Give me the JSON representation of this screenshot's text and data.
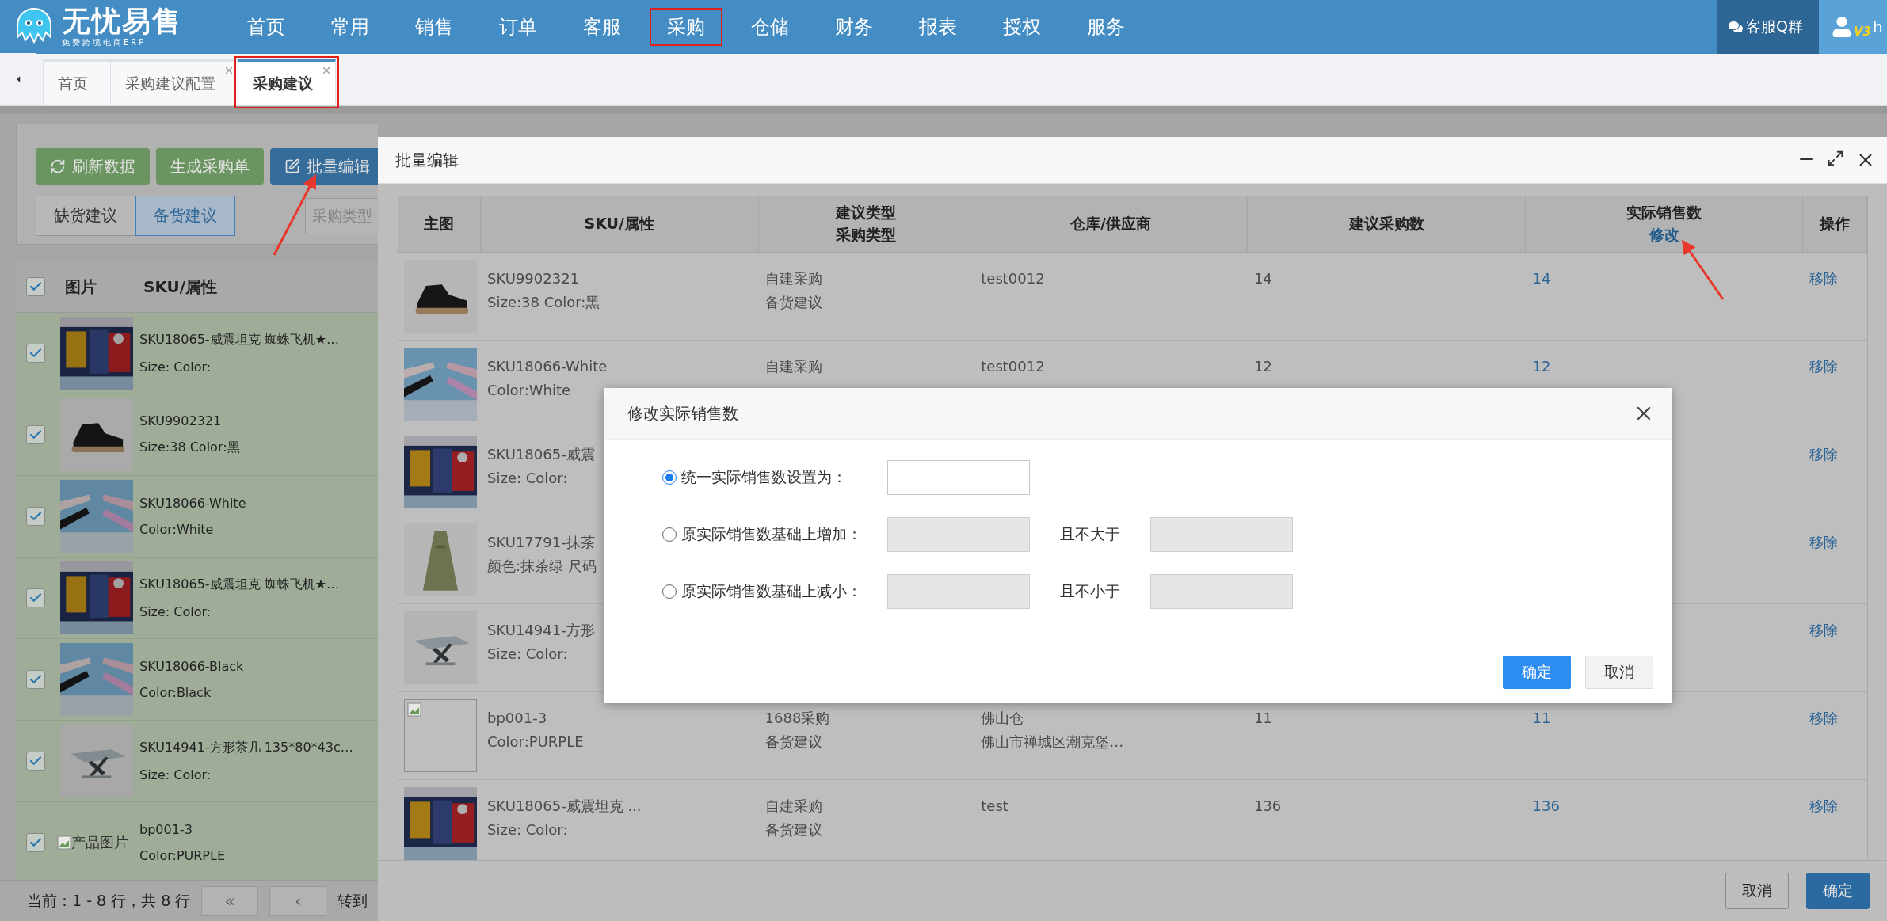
{
  "logo": {
    "title": "无忧易售",
    "subtitle": "免费跨境电商ERP"
  },
  "nav": [
    {
      "label": "首页",
      "highlighted": false
    },
    {
      "label": "常用",
      "highlighted": false
    },
    {
      "label": "销售",
      "highlighted": false
    },
    {
      "label": "订单",
      "highlighted": false
    },
    {
      "label": "客服",
      "highlighted": false
    },
    {
      "label": "采购",
      "highlighted": true
    },
    {
      "label": "仓储",
      "highlighted": false
    },
    {
      "label": "财务",
      "highlighted": false
    },
    {
      "label": "报表",
      "highlighted": false
    },
    {
      "label": "授权",
      "highlighted": false
    },
    {
      "label": "服务",
      "highlighted": false
    }
  ],
  "support_button": "客服Q群",
  "user": {
    "badge": "V3",
    "name": "h"
  },
  "tabs": [
    {
      "label": "首页",
      "selected": false,
      "closable": false,
      "highlighted": false
    },
    {
      "label": "采购建议配置",
      "selected": false,
      "closable": true,
      "highlighted": false
    },
    {
      "label": "采购建议",
      "selected": true,
      "closable": true,
      "highlighted": true
    }
  ],
  "toolbar": {
    "buttons": [
      {
        "label": "刷新数据",
        "kind": "refresh"
      },
      {
        "label": "生成采购单",
        "kind": "plain"
      },
      {
        "label": "批量编辑",
        "kind": "edit"
      }
    ],
    "segments": [
      {
        "label": "缺货建议",
        "selected": false
      },
      {
        "label": "备货建议",
        "selected": true
      }
    ],
    "type_select": {
      "placeholder": "采购类型"
    }
  },
  "list": {
    "all_checked": true,
    "columns": [
      "图片",
      "SKU/属性"
    ],
    "rows": [
      {
        "checked": true,
        "kind": "picture",
        "sku": "SKU18065-威震坦克 蜘蛛飞机★…",
        "attrs": "Size: Color:"
      },
      {
        "checked": true,
        "kind": "picture",
        "sku": "SKU9902321",
        "attrs": "Size:38 Color:黑"
      },
      {
        "checked": true,
        "kind": "picture",
        "sku": "SKU18066-White",
        "attrs": "Color:White"
      },
      {
        "checked": true,
        "kind": "picture",
        "sku": "SKU18065-威震坦克 蜘蛛飞机★…",
        "attrs": "Size: Color:"
      },
      {
        "checked": true,
        "kind": "picture",
        "sku": "SKU18066-Black",
        "attrs": "Color:Black"
      },
      {
        "checked": true,
        "kind": "picture",
        "sku": "SKU14941-方形茶几 135*80*43c…",
        "attrs": "Size: Color:"
      },
      {
        "checked": true,
        "kind": "broken",
        "image_alt": "产品图片",
        "sku": "bp001-3",
        "attrs": "Color:PURPLE"
      }
    ]
  },
  "pager": {
    "summary": "当前：1 - 8 行，共 8 行",
    "first": "«",
    "prev": "‹",
    "goto": "转到"
  },
  "batch_modal": {
    "title": "批量编辑",
    "columns": [
      {
        "label": "主图"
      },
      {
        "label": "SKU/属性"
      },
      {
        "label": "建议类型",
        "sub": "采购类型"
      },
      {
        "label": "仓库/供应商"
      },
      {
        "label": "建议采购数"
      },
      {
        "label": "实际销售数",
        "link": "修改"
      },
      {
        "label": "操作"
      }
    ],
    "rows": [
      {
        "kind": "picture",
        "sku": "SKU9902321",
        "attrs": "Size:38 Color:黑",
        "type_lines": [
          "自建采购",
          "备货建议"
        ],
        "warehouse_lines": [
          "test0012"
        ],
        "suggested_qty": "14",
        "actual_qty": "14",
        "action": "移除"
      },
      {
        "kind": "picture",
        "sku": "SKU18066-White",
        "attrs": "Color:White",
        "type_lines": [
          "自建采购"
        ],
        "warehouse_lines": [
          "test0012"
        ],
        "suggested_qty": "12",
        "actual_qty": "12",
        "action": "移除"
      },
      {
        "kind": "picture",
        "sku": "SKU18065-威震",
        "attrs": "Size: Color:",
        "action": "移除"
      },
      {
        "kind": "picture",
        "sku": "SKU17791-抹茶",
        "attrs": "颜色:抹茶绿 尺码",
        "action": "移除"
      },
      {
        "kind": "picture",
        "sku": "SKU14941-方形",
        "attrs": "Size: Color:",
        "action": "移除"
      },
      {
        "kind": "broken",
        "sku": "bp001-3",
        "attrs": "Color:PURPLE",
        "type_lines": [
          "1688采购",
          "备货建议"
        ],
        "warehouse_lines": [
          "佛山仓",
          "佛山市禅城区潮克堡…"
        ],
        "suggested_qty": "11",
        "actual_qty": "11",
        "action": "移除"
      },
      {
        "kind": "picture",
        "sku": "SKU18065-威震坦克 ...",
        "attrs": "Size: Color:",
        "type_lines": [
          "自建采购",
          "备货建议"
        ],
        "warehouse_lines": [
          "test"
        ],
        "suggested_qty": "136",
        "actual_qty": "136",
        "action": "移除"
      }
    ],
    "cancel": "取消",
    "confirm": "确定"
  },
  "dialog": {
    "title": "修改实际销售数",
    "options": [
      {
        "label": "统一实际销售数设置为：",
        "selected": true,
        "field_disabled": false
      },
      {
        "label": "原实际销售数基础上增加：",
        "selected": false,
        "field_disabled": true,
        "limit_label": "且不大于",
        "limit_disabled": true
      },
      {
        "label": "原实际销售数基础上减小：",
        "selected": false,
        "field_disabled": true,
        "limit_label": "且不小于",
        "limit_disabled": true
      }
    ],
    "confirm": "确定",
    "cancel": "取消"
  }
}
